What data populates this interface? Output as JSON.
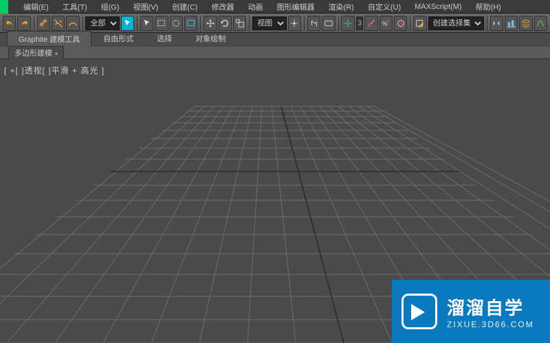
{
  "menu": {
    "items": [
      "编辑(E)",
      "工具(T)",
      "组(G)",
      "视图(V)",
      "创建(C)",
      "修改器",
      "动画",
      "图形编辑器",
      "渲染(R)",
      "自定义(U)",
      "MAXScript(M)",
      "帮助(H)"
    ]
  },
  "toolbar": {
    "group_dropdown": "全部",
    "view_dropdown": "视图",
    "angle_value": "3",
    "selection_set": "创建选择集"
  },
  "ribbon": {
    "tabs": [
      "Graphite 建模工具",
      "自由形式",
      "选择",
      "对象绘制"
    ],
    "subrow": "多边形建模"
  },
  "viewport": {
    "label": "[ +[ ]透视[ ]平滑 + 高光  ]"
  },
  "watermark": {
    "title": "溜溜自学",
    "sub": "ZIXUE.3D66.COM"
  }
}
